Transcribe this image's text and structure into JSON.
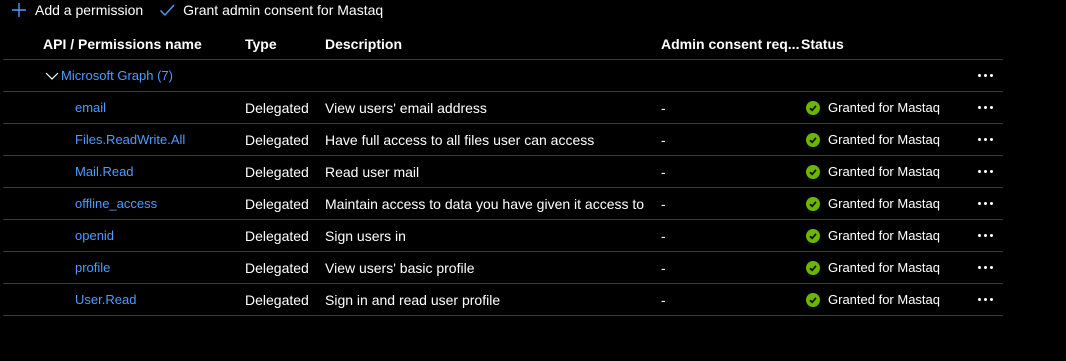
{
  "toolbar": {
    "add_permission": "Add a permission",
    "grant_consent": "Grant admin consent for Mastaq"
  },
  "columns": {
    "api": "API / Permissions name",
    "type": "Type",
    "description": "Description",
    "admin_consent": "Admin consent req...",
    "status": "Status"
  },
  "group": {
    "label": "Microsoft Graph (7)"
  },
  "permissions": [
    {
      "name": "email",
      "type": "Delegated",
      "description": "View users' email address",
      "admin": "-",
      "status": "Granted for Mastaq"
    },
    {
      "name": "Files.ReadWrite.All",
      "type": "Delegated",
      "description": "Have full access to all files user can access",
      "admin": "-",
      "status": "Granted for Mastaq"
    },
    {
      "name": "Mail.Read",
      "type": "Delegated",
      "description": "Read user mail",
      "admin": "-",
      "status": "Granted for Mastaq"
    },
    {
      "name": "offline_access",
      "type": "Delegated",
      "description": "Maintain access to data you have given it access to",
      "admin": "-",
      "status": "Granted for Mastaq"
    },
    {
      "name": "openid",
      "type": "Delegated",
      "description": "Sign users in",
      "admin": "-",
      "status": "Granted for Mastaq"
    },
    {
      "name": "profile",
      "type": "Delegated",
      "description": "View users' basic profile",
      "admin": "-",
      "status": "Granted for Mastaq"
    },
    {
      "name": "User.Read",
      "type": "Delegated",
      "description": "Sign in and read user profile",
      "admin": "-",
      "status": "Granted for Mastaq"
    }
  ],
  "colors": {
    "link": "#4f9bff",
    "accent": "#4f9bff",
    "granted": "#6bb700",
    "divider": "#3b3a39"
  },
  "icons": {
    "add": "plus-icon",
    "grant": "checkmark-icon",
    "expand": "chevron-down-icon",
    "granted": "check-circle-icon",
    "more": "more-icon"
  }
}
